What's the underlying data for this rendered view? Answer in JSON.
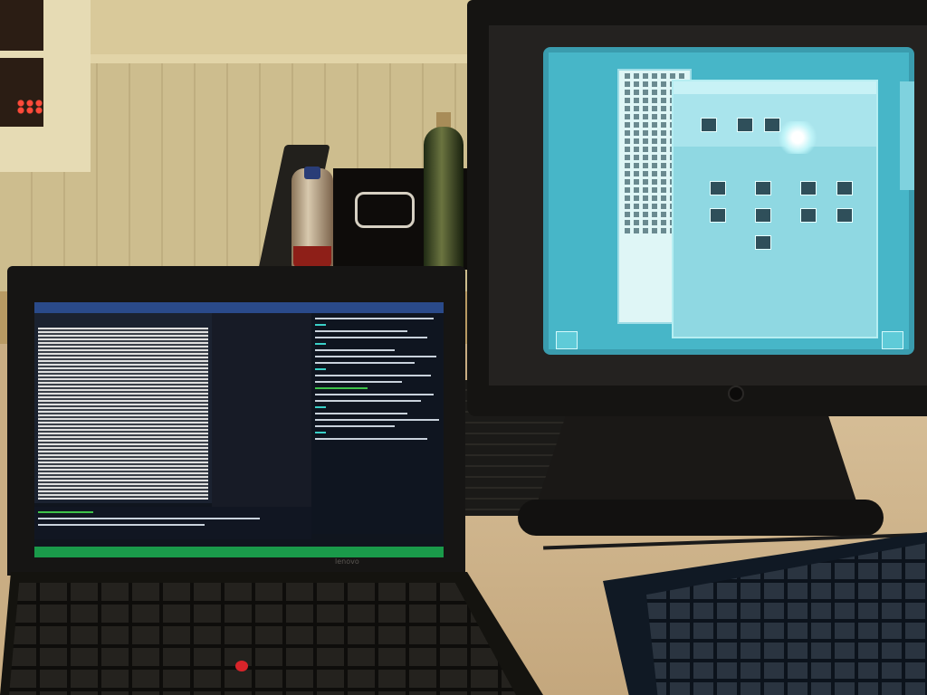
{
  "scene": {
    "laptop": {
      "brand": "lenovo"
    }
  }
}
